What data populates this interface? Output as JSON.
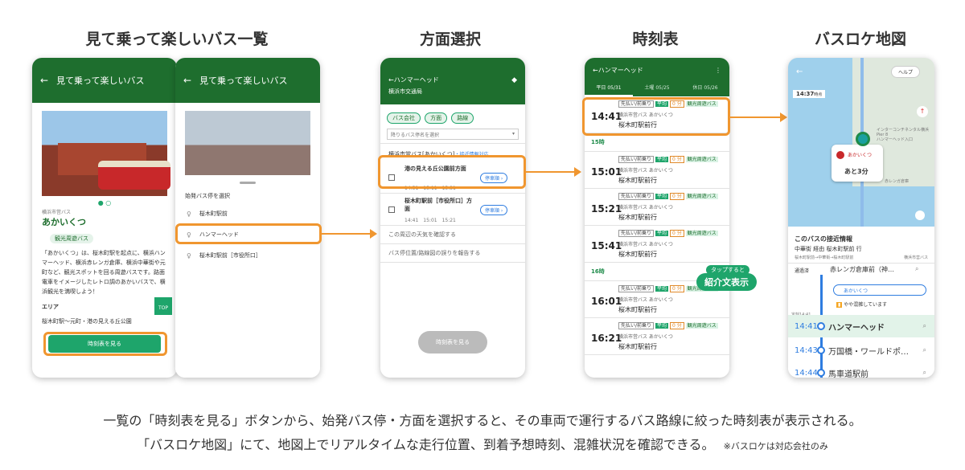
{
  "titles": {
    "list": "見て乗って楽しいバス一覧",
    "direction": "方面選択",
    "timetable": "時刻表",
    "map": "バスロケ地図"
  },
  "phone1": {
    "header": "見て乗って楽しいバス",
    "operator": "横浜市営バス",
    "bus_name": "あかいくつ",
    "chip": "観光周遊バス",
    "description": "「あかいくつ」は、桜木町駅を起点に、横浜ハンマーヘッド、横浜赤レンガ倉庫、横浜中華街や元町など、観光スポットを回る周遊バスです。路面電車をイメージしたレトロ調のあかいバスで、横浜観光を満喫しよう！",
    "area_label": "エリア",
    "area": "桜木町駅〜元町・港の見える丘公園",
    "button": "時刻表を見る",
    "top": "TOP"
  },
  "phone2": {
    "header": "見て乗って楽しいバス",
    "sheet_title": "始発バス停を選択",
    "stops": [
      "桜木町駅前",
      "ハンマーヘッド",
      "桜木町駅前［市役所口］"
    ]
  },
  "phone3": {
    "header": "ハンマーヘッド",
    "operator": "横浜市交通局",
    "filters": [
      "バス会社",
      "方面",
      "路線"
    ],
    "select_placeholder": "降りるバス停名を選択",
    "group_title": "横浜市営バス[あかいくつ]",
    "group_note": "・接近情報対応",
    "dirs": [
      {
        "name": "港の見える丘公園前方面",
        "times": "14:51　15:11　15:31",
        "btn": "停車順"
      },
      {
        "name": "桜木町駅前［市役所口］方面",
        "times": "14:41　15:01　15:21",
        "btn": "停車順"
      }
    ],
    "links": [
      "この周辺の天気を確認する",
      "バス停位置/路線図の誤りを報告する"
    ],
    "button": "時刻表を見る"
  },
  "phone4": {
    "header": "ハンマーヘッド",
    "tabs": [
      {
        "label": "平日",
        "date": "05/31"
      },
      {
        "label": "土曜",
        "date": "05/25"
      },
      {
        "label": "休日",
        "date": "05/26"
      }
    ],
    "tag_a": "先払い/前乗り",
    "tag_b": "平均",
    "tag_c": "0 分",
    "tag_d": "観光周遊バス",
    "sub": "横浜市営バス あかいくつ",
    "dest": "桜木町駅前行",
    "rows_top": [
      "14:41"
    ],
    "hour15": "15時",
    "rows_15": [
      "15:01",
      "15:21",
      "15:41"
    ],
    "hour16": "16時",
    "rows_16": [
      "16:01",
      "16:21"
    ],
    "tooltip_small": "タップすると",
    "tooltip_big": "紹介文表示"
  },
  "phone5": {
    "help": "ヘルプ",
    "time": "14:37",
    "time_note": "時点",
    "bubble_name": "あかいくつ",
    "bubble_eta": "あと3分",
    "panel_title": "このバスの接近情報",
    "route": "中華街 経由 桜木町駅前 行",
    "route_sub": "桜木町駅前→中華街→桜木町駅前",
    "operator": "横浜市営バス",
    "passed": "通過済",
    "stop1": "赤レンガ倉庫前（神…",
    "bus_label": "あかいくつ",
    "crowd": "やや混雑しています",
    "sched": "定刻14:41",
    "rows": [
      {
        "time": "14:41",
        "name": "ハンマーヘッド"
      },
      {
        "time": "14:43",
        "name": "万国橋・ワールドポ…"
      },
      {
        "time": "14:44",
        "name": "馬車道駅前"
      }
    ],
    "poi": [
      "インターコンチネンタル横浜 Pier 8",
      "ハンマーヘッド入口",
      "赤レンガ倉庫"
    ]
  },
  "captions": {
    "line1": "一覧の「時刻表を見る」ボタンから、始発バス停・方面を選択すると、その車両で運行するバス路線に絞った時刻表が表示される。",
    "line2": "「バスロケ地図」にて、地図上でリアルタイムな走行位置、到着予想時刻、混雑状況を確認できる。",
    "note": "※バスロケは対応会社のみ"
  },
  "colors": {
    "green": "#1e6e2e",
    "accent": "#1ea56b",
    "orange": "#f0962f",
    "blue": "#2f7de0"
  }
}
